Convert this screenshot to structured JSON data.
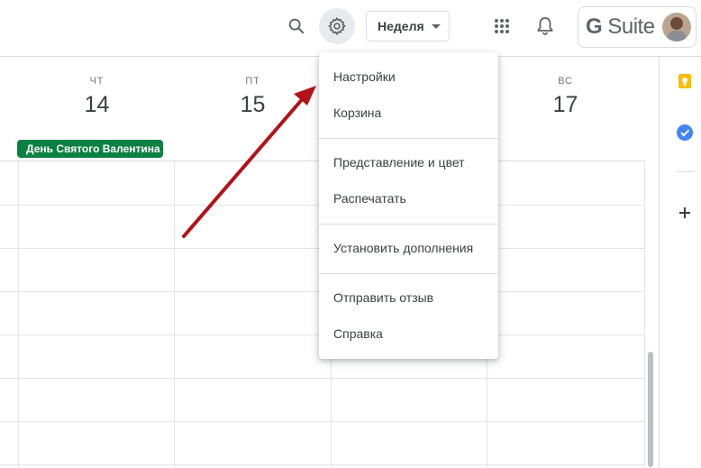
{
  "header": {
    "view_select": {
      "value": "Неделя"
    },
    "gsuite_badge": {
      "g": "G",
      "rest": " Suite"
    },
    "icons": {
      "search": "search-icon",
      "settings": "gear-icon",
      "apps": "apps-grid-icon",
      "notifications": "bell-icon"
    }
  },
  "days": [
    {
      "name": "ЧТ",
      "number": "14"
    },
    {
      "name": "ПТ",
      "number": "15"
    },
    {
      "name": "",
      "number": ""
    },
    {
      "name": "ВС",
      "number": "17"
    }
  ],
  "event": {
    "title": "День Святого Валентина",
    "color": "#0b8043"
  },
  "settings_menu": {
    "items": [
      "Настройки",
      "Корзина",
      "Представление и цвет",
      "Распечатать",
      "Установить дополнения",
      "Отправить отзыв",
      "Справка"
    ]
  },
  "side_panel": {
    "icons": [
      "keep-icon",
      "tasks-icon",
      "add-icon"
    ]
  },
  "annotation": {
    "color": "#b31217"
  },
  "colors": {
    "accent": "#1a73e8",
    "event": "#0b8043",
    "divider": "#dadce0"
  }
}
